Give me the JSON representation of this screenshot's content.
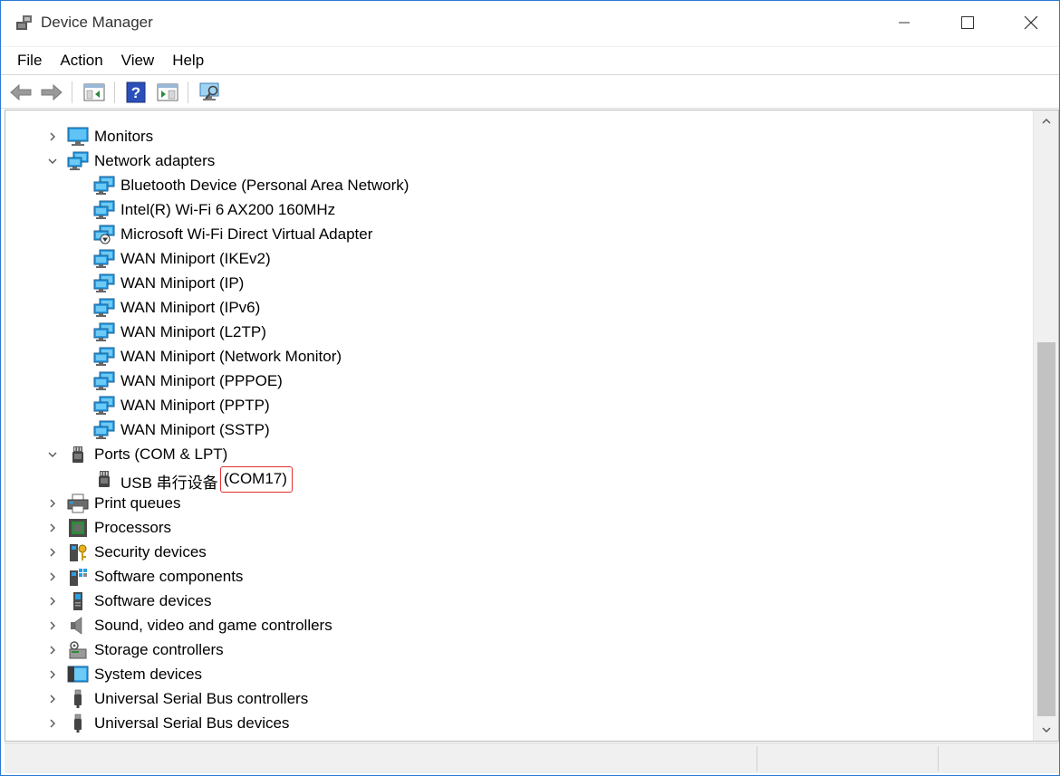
{
  "window": {
    "title": "Device Manager"
  },
  "menu": [
    "File",
    "Action",
    "View",
    "Help"
  ],
  "toolbar": {
    "buttons": [
      "back-arrow-icon",
      "forward-arrow-icon",
      "show-hide-tree-icon",
      "help-icon",
      "properties-icon",
      "scan-hardware-icon"
    ]
  },
  "tree": {
    "nodes": [
      {
        "label": "Monitors",
        "level": 0,
        "expanded": false,
        "icon": "monitor-icon"
      },
      {
        "label": "Network adapters",
        "level": 0,
        "expanded": true,
        "icon": "network-adapter-icon"
      },
      {
        "label": "Bluetooth Device (Personal Area Network)",
        "level": 1,
        "icon": "network-adapter-icon"
      },
      {
        "label": "Intel(R) Wi-Fi 6 AX200 160MHz",
        "level": 1,
        "icon": "network-adapter-icon"
      },
      {
        "label": "Microsoft Wi-Fi Direct Virtual Adapter",
        "level": 1,
        "icon": "network-adapter-disabled-icon"
      },
      {
        "label": "WAN Miniport (IKEv2)",
        "level": 1,
        "icon": "network-adapter-icon"
      },
      {
        "label": "WAN Miniport (IP)",
        "level": 1,
        "icon": "network-adapter-icon"
      },
      {
        "label": "WAN Miniport (IPv6)",
        "level": 1,
        "icon": "network-adapter-icon"
      },
      {
        "label": "WAN Miniport (L2TP)",
        "level": 1,
        "icon": "network-adapter-icon"
      },
      {
        "label": "WAN Miniport (Network Monitor)",
        "level": 1,
        "icon": "network-adapter-icon"
      },
      {
        "label": "WAN Miniport (PPPOE)",
        "level": 1,
        "icon": "network-adapter-icon"
      },
      {
        "label": "WAN Miniport (PPTP)",
        "level": 1,
        "icon": "network-adapter-icon"
      },
      {
        "label": "WAN Miniport (SSTP)",
        "level": 1,
        "icon": "network-adapter-icon"
      },
      {
        "label": "Ports (COM & LPT)",
        "level": 0,
        "expanded": true,
        "icon": "port-icon"
      },
      {
        "label": "USB 串行设备",
        "suffix": "(COM17)",
        "level": 1,
        "icon": "port-icon",
        "highlighted_suffix": true
      },
      {
        "label": "Print queues",
        "level": 0,
        "expanded": false,
        "icon": "printer-icon"
      },
      {
        "label": "Processors",
        "level": 0,
        "expanded": false,
        "icon": "processor-icon"
      },
      {
        "label": "Security devices",
        "level": 0,
        "expanded": false,
        "icon": "security-device-icon"
      },
      {
        "label": "Software components",
        "level": 0,
        "expanded": false,
        "icon": "software-component-icon"
      },
      {
        "label": "Software devices",
        "level": 0,
        "expanded": false,
        "icon": "software-device-icon"
      },
      {
        "label": "Sound, video and game controllers",
        "level": 0,
        "expanded": false,
        "icon": "speaker-icon"
      },
      {
        "label": "Storage controllers",
        "level": 0,
        "expanded": false,
        "icon": "storage-controller-icon"
      },
      {
        "label": "System devices",
        "level": 0,
        "expanded": false,
        "icon": "system-device-icon"
      },
      {
        "label": "Universal Serial Bus controllers",
        "level": 0,
        "expanded": false,
        "icon": "usb-icon"
      },
      {
        "label": "Universal Serial Bus devices",
        "level": 0,
        "expanded": false,
        "icon": "usb-icon"
      }
    ]
  },
  "colors": {
    "highlight_border": "#e0302e",
    "icon_blue": "#1e90d8",
    "icon_dark": "#3a3a3a"
  }
}
